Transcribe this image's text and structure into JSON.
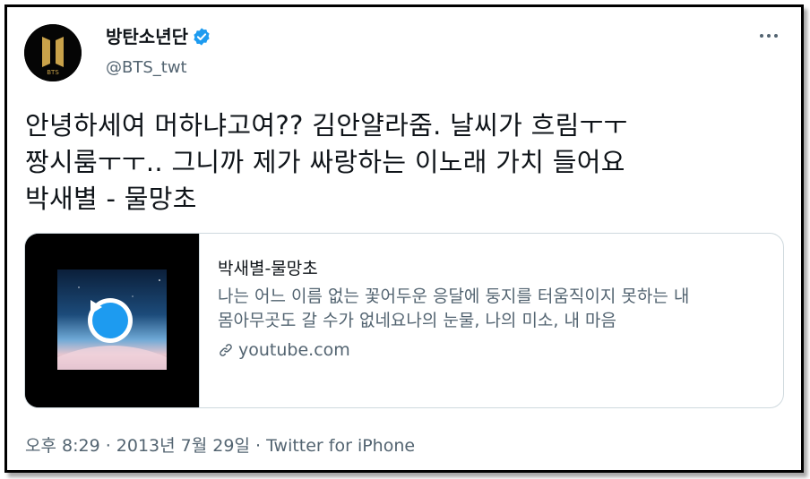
{
  "user": {
    "display_name": "방탄소년단",
    "handle": "@BTS_twt",
    "avatar_text": "BTS",
    "verified_icon": "verified-badge-icon"
  },
  "tweet": {
    "text": "안녕하세여 머하냐고여?? 김안얄라줌. 날씨가 흐림ㅜㅜ\n짱시룸ㅜㅜ.. 그니까 제가 싸랑하는 이노래 가치 들어요\n박새별 - 물망초"
  },
  "card": {
    "title": "박새별-물망초",
    "description": "나는 어느 이름 없는 꽃어두운 응달에 둥지를 터움직이지 못하는 내 몸아무곳도 갈 수가 없네요나의 눈물, 나의 미소, 내 마음",
    "domain": "youtube.com",
    "play_icon": "play-icon",
    "link_icon": "link-icon"
  },
  "meta": {
    "time": "오후 8:29",
    "separator1": " · ",
    "date": "2013년 7월 29일",
    "separator2": " · ",
    "source": "Twitter for iPhone"
  },
  "colors": {
    "accent": "#1d9bf0",
    "text_primary": "#0f1419",
    "text_secondary": "#536471",
    "border": "#cfd9de",
    "logo_gold": "#c9a24a"
  }
}
